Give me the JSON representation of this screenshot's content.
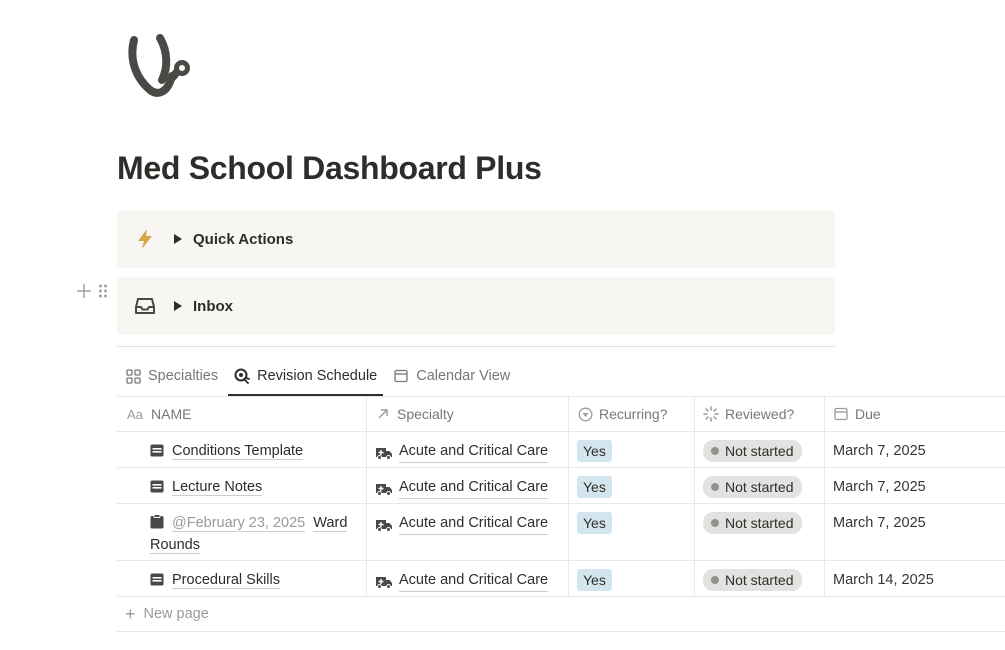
{
  "page": {
    "icon": "stethoscope-icon",
    "title": "Med School Dashboard Plus"
  },
  "callouts": [
    {
      "icon": "lightning-icon",
      "label": "Quick Actions",
      "icon_color": "#d9a448"
    },
    {
      "icon": "inbox-icon",
      "label": "Inbox"
    }
  ],
  "views": [
    {
      "label": "Specialties",
      "icon": "gallery-icon",
      "active": false
    },
    {
      "label": "Revision Schedule",
      "icon": "revision-icon",
      "active": true
    },
    {
      "label": "Calendar View",
      "icon": "calendar-icon",
      "active": false
    }
  ],
  "table": {
    "columns": [
      {
        "label": "NAME",
        "icon_text": "Aa",
        "icon": "text-property-icon"
      },
      {
        "label": "Specialty",
        "icon": "relation-arrow-icon"
      },
      {
        "label": "Recurring?",
        "icon": "select-icon"
      },
      {
        "label": "Reviewed?",
        "icon": "status-icon"
      },
      {
        "label": "Due",
        "icon": "date-icon"
      }
    ],
    "rows": [
      {
        "icon": "calendar-page-icon",
        "mention": "",
        "name": "Conditions Template",
        "specialty": "Acute and Critical Care",
        "recurring": "Yes",
        "reviewed": "Not started",
        "due": "March 7, 2025"
      },
      {
        "icon": "calendar-page-icon",
        "mention": "",
        "name": "Lecture Notes",
        "specialty": "Acute and Critical Care",
        "recurring": "Yes",
        "reviewed": "Not started",
        "due": "March 7, 2025"
      },
      {
        "icon": "clipboard-icon",
        "mention": "@February 23, 2025",
        "name": "Ward Rounds",
        "specialty": "Acute and Critical Care",
        "recurring": "Yes",
        "reviewed": "Not started",
        "due": "March 7, 2025"
      },
      {
        "icon": "calendar-page-icon",
        "mention": "",
        "name": "Procedural Skills",
        "specialty": "Acute and Critical Care",
        "recurring": "Yes",
        "reviewed": "Not started",
        "due": "March 14, 2025"
      }
    ],
    "new_page_label": "New page"
  },
  "colors": {
    "yes_tag_bg": "#d3e5ef",
    "status_bg": "#e3e2e0",
    "callout_bg": "#f7f6f3"
  }
}
